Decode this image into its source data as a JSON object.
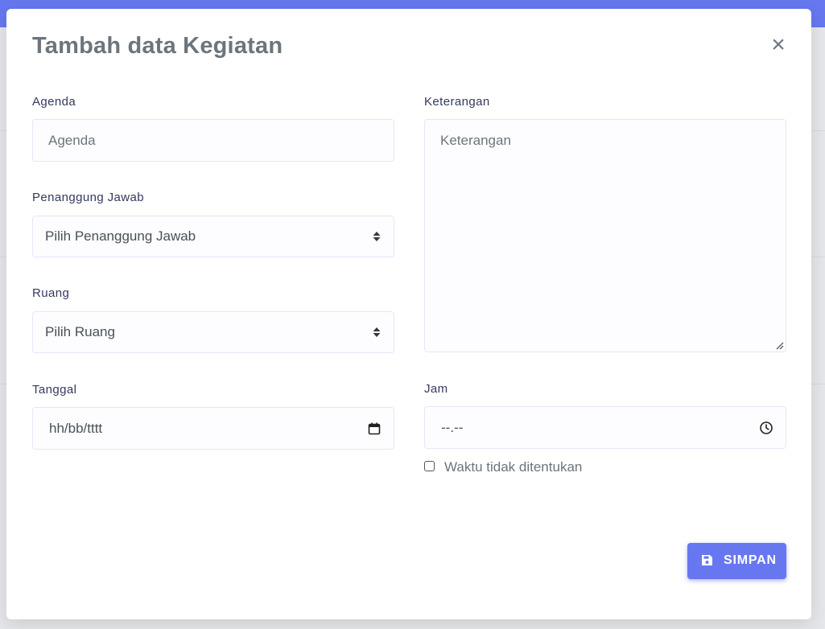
{
  "modal": {
    "title": "Tambah data Kegiatan",
    "close_symbol": "×"
  },
  "form": {
    "agenda": {
      "label": "Agenda",
      "placeholder": "Agenda",
      "value": ""
    },
    "penanggung_jawab": {
      "label": "Penanggung Jawab",
      "selected": "Pilih Penanggung Jawab"
    },
    "ruang": {
      "label": "Ruang",
      "selected": "Pilih Ruang"
    },
    "tanggal": {
      "label": "Tanggal",
      "placeholder": "hh/bb/tttt"
    },
    "keterangan": {
      "label": "Keterangan",
      "placeholder": "Keterangan"
    },
    "jam": {
      "label": "Jam",
      "placeholder": "--.--"
    },
    "waktu_tidak_ditentukan": {
      "label": "Waktu tidak ditentukan",
      "checked": false
    }
  },
  "actions": {
    "save_label": "SIMPAN"
  },
  "icons": {
    "close": "close-icon",
    "select_caret": "sort-caret-icon",
    "date": "calendar-icon",
    "time": "clock-icon",
    "save": "floppy-disk-icon"
  },
  "colors": {
    "primary": "#6777ef",
    "title": "#6c757d",
    "label": "#34395e",
    "field_bg": "#fdfdff",
    "field_border": "#e4e6fc"
  }
}
